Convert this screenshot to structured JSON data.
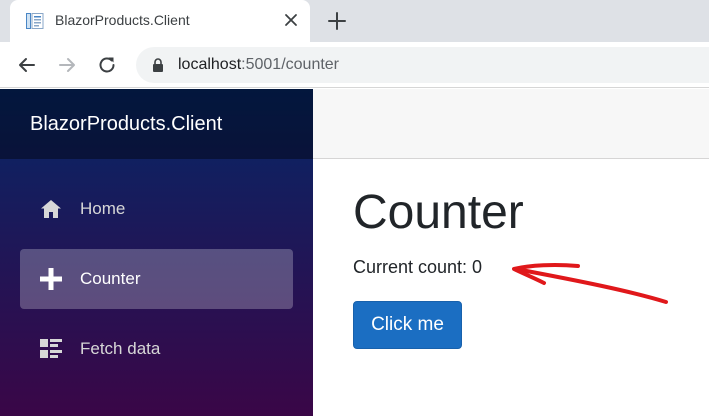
{
  "browser": {
    "tab": {
      "title": "BlazorProducts.Client",
      "favicon": "document-icon",
      "close_icon": "close-icon"
    },
    "new_tab_icon": "plus-icon",
    "nav": {
      "back_icon": "arrow-left-icon",
      "forward_icon": "arrow-right-icon",
      "reload_icon": "reload-icon"
    },
    "address": {
      "host": "localhost",
      "path": ":5001/counter",
      "lock_icon": "lock-icon"
    }
  },
  "app": {
    "brand": "BlazorProducts.Client",
    "sidebar": {
      "items": [
        {
          "label": "Home",
          "icon": "home-icon",
          "active": false
        },
        {
          "label": "Counter",
          "icon": "plus-icon",
          "active": true
        },
        {
          "label": "Fetch data",
          "icon": "list-rich-icon",
          "active": false
        }
      ]
    },
    "page": {
      "title": "Counter",
      "count_text": "Current count: 0",
      "button_label": "Click me"
    }
  },
  "colors": {
    "sidebar_top": "#052767",
    "sidebar_bottom": "#3a0647",
    "button": "#1b6ec2",
    "annotation_arrow": "#e0181b"
  }
}
